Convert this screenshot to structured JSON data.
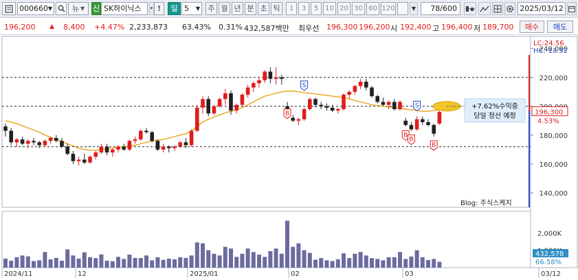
{
  "toolbar": {
    "code": "000660",
    "news_label": "뉴",
    "credit_label": "신",
    "stock_name": "SK하이닉스",
    "alert_label": "!",
    "period_active": "일",
    "period_count": "5",
    "periods": [
      "주",
      "월",
      "년",
      "분",
      "초",
      "틱"
    ],
    "intervals": [
      "1",
      "3",
      "5",
      "10",
      "20",
      "30",
      "60",
      "120"
    ],
    "bar_count": "78/600",
    "date": "2025/03/12"
  },
  "quote": {
    "price": "196,200",
    "change": "8,400",
    "change_pct": "+4.47%",
    "volume": "2,233,873",
    "vol_ratio": "63.43%",
    "turnover_pct": "0.31%",
    "trade_value": "432,587백만",
    "best_ask_label": "최우선",
    "best_ask": "196,300",
    "best_bid": "196,200",
    "open_label": "시",
    "open": "192,400",
    "high_label": "고",
    "high": "196,400",
    "low_label": "저",
    "low": "189,700",
    "buy_label": "매수",
    "sell_label": "매도"
  },
  "chart_data": {
    "type": "candlestick",
    "y_ticks": [
      "240,000",
      "220,000",
      "200,000",
      "180,000",
      "160,000",
      "140,000"
    ],
    "ylim": [
      130000,
      247000
    ],
    "x_labels": [
      "2024/11",
      "12",
      "2025/01",
      "02",
      "03",
      "03/12"
    ],
    "lc_label": "LC:24.56",
    "hc_label": "HC:-13.52",
    "last_price_label": "196,300",
    "last_change_label": "4.53%",
    "annotation": "+7.62%수익중\n당일 청산 예정",
    "watermark": "Blog: 주식스케치",
    "signals": [
      "B",
      "S",
      "B",
      "B",
      "S",
      "B"
    ],
    "candles": [
      [
        186000,
        188000,
        179000,
        183000
      ],
      [
        183000,
        185000,
        173000,
        175000
      ],
      [
        175000,
        178000,
        172000,
        177000
      ],
      [
        177000,
        179000,
        173000,
        174000
      ],
      [
        174000,
        177000,
        171000,
        176000
      ],
      [
        176000,
        178000,
        173000,
        175000
      ],
      [
        175000,
        176000,
        171000,
        173000
      ],
      [
        173000,
        177000,
        172000,
        176000
      ],
      [
        176000,
        179000,
        174000,
        178000
      ],
      [
        178000,
        180000,
        175000,
        176000
      ],
      [
        176000,
        178000,
        171000,
        172000
      ],
      [
        172000,
        174000,
        166000,
        167000
      ],
      [
        167000,
        169000,
        160000,
        162000
      ],
      [
        162000,
        165000,
        159000,
        163000
      ],
      [
        163000,
        167000,
        160000,
        161000
      ],
      [
        161000,
        166000,
        160000,
        165000
      ],
      [
        165000,
        169000,
        163000,
        168000
      ],
      [
        168000,
        174000,
        167000,
        172000
      ],
      [
        172000,
        174000,
        166000,
        168000
      ],
      [
        168000,
        171000,
        165000,
        170000
      ],
      [
        170000,
        173000,
        168000,
        172000
      ],
      [
        172000,
        174000,
        169000,
        170000
      ],
      [
        170000,
        177000,
        169000,
        176000
      ],
      [
        176000,
        179000,
        174000,
        177000
      ],
      [
        177000,
        184000,
        176000,
        183000
      ],
      [
        183000,
        185000,
        181000,
        182000
      ],
      [
        182000,
        183000,
        175000,
        176000
      ],
      [
        176000,
        177000,
        169000,
        170000
      ],
      [
        170000,
        174000,
        168000,
        172000
      ],
      [
        172000,
        173000,
        168000,
        171000
      ],
      [
        171000,
        173000,
        169000,
        172000
      ],
      [
        172000,
        176000,
        171000,
        175000
      ],
      [
        175000,
        178000,
        171000,
        173000
      ],
      [
        173000,
        184000,
        172000,
        183000
      ],
      [
        183000,
        201000,
        182000,
        199000
      ],
      [
        199000,
        207000,
        195000,
        205000
      ],
      [
        205000,
        207000,
        193000,
        195000
      ],
      [
        195000,
        201000,
        194000,
        200000
      ],
      [
        200000,
        206000,
        199000,
        205000
      ],
      [
        205000,
        212000,
        201000,
        209000
      ],
      [
        209000,
        211000,
        194000,
        197000
      ],
      [
        197000,
        202000,
        195000,
        201000
      ],
      [
        201000,
        209000,
        200000,
        208000
      ],
      [
        208000,
        215000,
        206000,
        213000
      ],
      [
        213000,
        217000,
        210000,
        216000
      ],
      [
        216000,
        220000,
        213000,
        218000
      ],
      [
        218000,
        225000,
        216000,
        224000
      ],
      [
        224000,
        227000,
        216000,
        219000
      ],
      [
        219000,
        227000,
        215000,
        220000
      ],
      [
        220000,
        222000,
        215000,
        219000
      ],
      [
        200000,
        203000,
        195000,
        196000
      ],
      [
        192000,
        194000,
        189000,
        190000
      ],
      [
        190000,
        192000,
        187000,
        191000
      ],
      [
        191000,
        199000,
        190000,
        198000
      ],
      [
        198000,
        206000,
        197000,
        205000
      ],
      [
        205000,
        206000,
        199000,
        201000
      ],
      [
        201000,
        203000,
        198000,
        200000
      ],
      [
        200000,
        202000,
        197000,
        199000
      ],
      [
        199000,
        201000,
        196000,
        197000
      ],
      [
        197000,
        199000,
        195000,
        198000
      ],
      [
        198000,
        209000,
        197000,
        208000
      ],
      [
        208000,
        211000,
        205000,
        210000
      ],
      [
        210000,
        215000,
        208000,
        214000
      ],
      [
        214000,
        219000,
        212000,
        217000
      ],
      [
        217000,
        219000,
        211000,
        213000
      ],
      [
        213000,
        214000,
        206000,
        207000
      ],
      [
        207000,
        208000,
        202000,
        203000
      ],
      [
        203000,
        206000,
        200000,
        201000
      ],
      [
        201000,
        204000,
        198000,
        203000
      ],
      [
        203000,
        205000,
        197000,
        198000
      ],
      [
        198000,
        204000,
        197000,
        203000
      ],
      [
        190000,
        192000,
        186000,
        187000
      ],
      [
        187000,
        189000,
        183000,
        184000
      ],
      [
        184000,
        193000,
        183000,
        191000
      ],
      [
        191000,
        193000,
        187000,
        189000
      ],
      [
        189000,
        191000,
        186000,
        187000
      ],
      [
        187000,
        188000,
        179000,
        181000
      ],
      [
        188000,
        197000,
        187000,
        196000
      ]
    ],
    "volumes": [
      520,
      400,
      600,
      700,
      650,
      380,
      420,
      900,
      480,
      560,
      400,
      1050,
      700,
      520,
      880,
      600,
      550,
      760,
      400,
      370,
      620,
      500,
      750,
      560,
      550,
      700,
      420,
      600,
      450,
      520,
      480,
      600,
      560,
      700,
      1450,
      1400,
      1000,
      800,
      700,
      1200,
      1100,
      620,
      800,
      1100,
      900,
      750,
      620,
      950,
      1100,
      800,
      2700,
      1200,
      1400,
      1000,
      850,
      460,
      550,
      420,
      380,
      480,
      820,
      550,
      800,
      900,
      700,
      550,
      500,
      420,
      600,
      600,
      900,
      500,
      640,
      1000,
      600,
      440,
      500,
      340
    ],
    "ma_values": [
      190000,
      189000,
      188000,
      186500,
      185000,
      183500,
      182000,
      180000,
      178500,
      177000,
      175500,
      174000,
      172500,
      171000,
      170000,
      169500,
      169500,
      170000,
      170500,
      171000,
      171500,
      172000,
      172500,
      173000,
      174000,
      175000,
      176000,
      176500,
      177000,
      178000,
      179000,
      180000,
      181000,
      183000,
      186000,
      189000,
      191000,
      192500,
      194000,
      195500,
      196500,
      197500,
      199000,
      201000,
      203000,
      205000,
      207000,
      208000,
      209000,
      210000,
      210500,
      210500,
      210000,
      209500,
      209000,
      208500,
      208000,
      207500,
      207000,
      206500,
      206000,
      205000,
      204000,
      203000,
      202000,
      201000,
      200500,
      200000,
      199500,
      199000,
      198500,
      198000,
      197500,
      197000,
      196500,
      196500,
      197000,
      197500
    ]
  }
}
